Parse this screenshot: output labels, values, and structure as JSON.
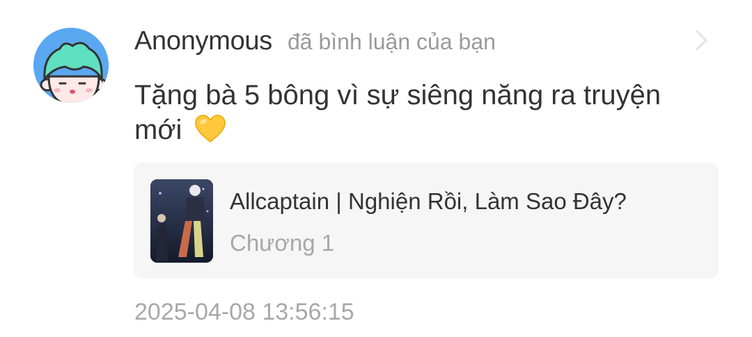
{
  "notification": {
    "user_name": "Anonymous",
    "action_text": "đã bình luận của bạn",
    "avatar_icon": "cartoon-character-avatar",
    "comment_text": "Tặng bà 5 bông vì sự siêng năng ra truyện mới",
    "comment_emoji_icon": "yellow-heart-icon",
    "story": {
      "title": "Allcaptain | Nghiện Rồi, Làm Sao Đây?",
      "chapter": "Chương 1",
      "cover_icon": "story-cover-thumbnail"
    },
    "timestamp": "2025-04-08 13:56:15",
    "chevron_icon": "chevron-right-icon"
  },
  "colors": {
    "avatar_background": "#5aa8f0",
    "primary_text": "#333333",
    "secondary_text": "#9a9a9a",
    "card_background": "#f6f6f6",
    "heart": "#ffc83d"
  }
}
